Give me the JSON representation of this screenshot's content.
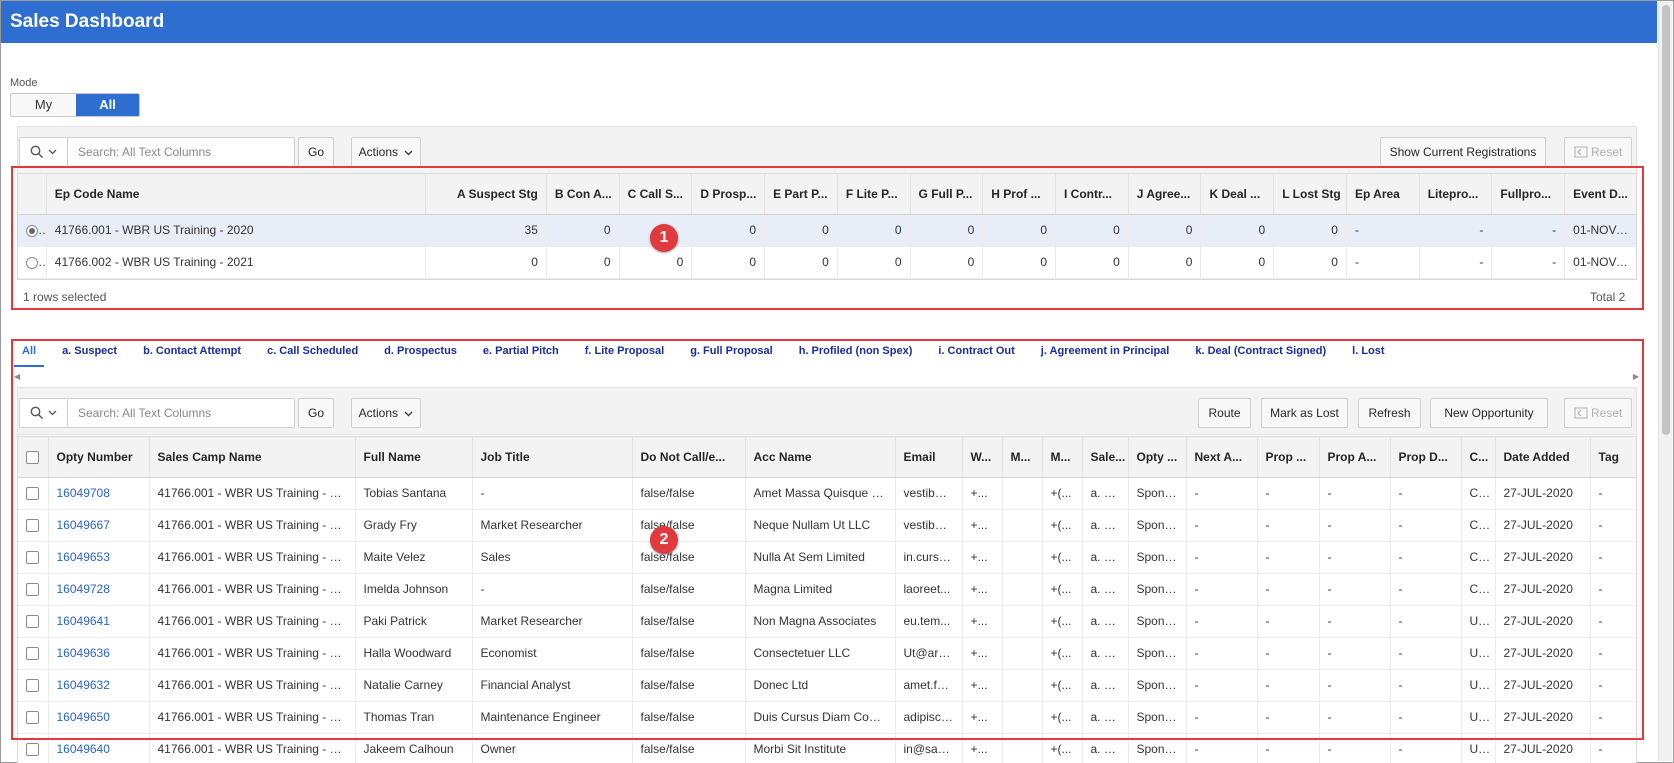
{
  "app": {
    "title": "Sales Dashboard"
  },
  "mode": {
    "label": "Mode",
    "options": [
      "My",
      "All"
    ],
    "selected": "All"
  },
  "top_toolbar": {
    "search_placeholder": "Search: All Text Columns",
    "go_label": "Go",
    "actions_label": "Actions",
    "show_current_label": "Show Current Registrations",
    "reset_label": "Reset"
  },
  "top_grid": {
    "columns": [
      "Ep Code Name",
      "A Suspect Stg",
      "B Con A...",
      "C Call S...",
      "D Prosp...",
      "E Part P...",
      "F Lite P...",
      "G Full P...",
      "H Prof ...",
      "I Contr...",
      "J Agree...",
      "K Deal ...",
      "L Lost Stg",
      "Ep Area",
      "Litepro...",
      "Fullpro...",
      "Event D..."
    ],
    "rows": [
      {
        "selected": true,
        "cells": [
          "41766.001 - WBR US Training - 2020",
          "35",
          "0",
          "",
          "0",
          "0",
          "0",
          "0",
          "0",
          "0",
          "0",
          "0",
          "0",
          "-",
          "-",
          "-",
          "01-NOV-..."
        ]
      },
      {
        "selected": false,
        "cells": [
          "41766.002 - WBR US Training - 2021",
          "0",
          "0",
          "0",
          "0",
          "0",
          "0",
          "0",
          "0",
          "0",
          "0",
          "0",
          "0",
          "-",
          "-",
          "-",
          "01-NOV-..."
        ]
      }
    ],
    "footer_left": "1 rows selected",
    "footer_right": "Total 2"
  },
  "tabs": [
    "All",
    "a. Suspect",
    "b. Contact Attempt",
    "c. Call Scheduled",
    "d. Prospectus",
    "e. Partial Pitch",
    "f. Lite Proposal",
    "g. Full Proposal",
    "h. Profiled (non Spex)",
    "i. Contract Out",
    "j. Agreement in Principal",
    "k. Deal (Contract Signed)",
    "l. Lost"
  ],
  "active_tab": "All",
  "bottom_toolbar": {
    "search_placeholder": "Search: All Text Columns",
    "go_label": "Go",
    "actions_label": "Actions",
    "route_label": "Route",
    "mark_lost_label": "Mark as Lost",
    "refresh_label": "Refresh",
    "new_opp_label": "New Opportunity",
    "reset_label": "Reset"
  },
  "bottom_grid": {
    "columns": [
      "Opty Number",
      "Sales Camp Name",
      "Full Name",
      "Job Title",
      "Do Not Call/e...",
      "Acc Name",
      "Email",
      "W...",
      "M...",
      "M...",
      "Sale...",
      "Opty ...",
      "Next A...",
      "Prop ...",
      "Prop A...",
      "Prop D...",
      "C...",
      "Date Added",
      "Tag"
    ],
    "rows": [
      [
        "16049708",
        "41766.001 - WBR US Training - 20...",
        "Tobias Santana",
        "-",
        "false/false",
        "Amet Massa Quisque C...",
        "vestibul...",
        "+...",
        "",
        "+(...",
        "a. Su...",
        "Spons...",
        "-",
        "-",
        "-",
        "-",
        "Ca...",
        "27-JUL-2020",
        "-"
      ],
      [
        "16049667",
        "41766.001 - WBR US Training - 20...",
        "Grady Fry",
        "Market Researcher",
        "false/false",
        "Neque Nullam Ut LLC",
        "vestibul...",
        "+...",
        "",
        "+(...",
        "a. Su...",
        "Spons...",
        "-",
        "-",
        "-",
        "-",
        "Ca...",
        "27-JUL-2020",
        "-"
      ],
      [
        "16049653",
        "41766.001 - WBR US Training - 20...",
        "Maite Velez",
        "Sales",
        "false/false",
        "Nulla At Sem Limited",
        "in.cursu...",
        "+...",
        "",
        "+(...",
        "a. Su...",
        "Spons...",
        "-",
        "-",
        "-",
        "-",
        "Ca...",
        "27-JUL-2020",
        "-"
      ],
      [
        "16049728",
        "41766.001 - WBR US Training - 20...",
        "Imelda Johnson",
        "-",
        "false/false",
        "Magna Limited",
        "laoreet...",
        "+...",
        "",
        "+(...",
        "a. Su...",
        "Spons...",
        "-",
        "-",
        "-",
        "-",
        "Ca...",
        "27-JUL-2020",
        "-"
      ],
      [
        "16049641",
        "41766.001 - WBR US Training - 20...",
        "Paki Patrick",
        "Market Researcher",
        "false/false",
        "Non Magna Associates",
        "eu.tem...",
        "+...",
        "",
        "+(...",
        "a. Su...",
        "Spons...",
        "-",
        "-",
        "-",
        "-",
        "U...",
        "27-JUL-2020",
        "-"
      ],
      [
        "16049636",
        "41766.001 - WBR US Training - 20...",
        "Halla Woodward",
        "Economist",
        "false/false",
        "Consectetuer LLC",
        "Ut@arc...",
        "+...",
        "",
        "+(...",
        "a. Su...",
        "Spons...",
        "-",
        "-",
        "-",
        "-",
        "U...",
        "27-JUL-2020",
        "-"
      ],
      [
        "16049632",
        "41766.001 - WBR US Training - 20...",
        "Natalie Carney",
        "Financial Analyst",
        "false/false",
        "Donec Ltd",
        "amet.fa...",
        "+...",
        "",
        "+(...",
        "a. Su...",
        "Spons...",
        "-",
        "-",
        "-",
        "-",
        "U...",
        "27-JUL-2020",
        "-"
      ],
      [
        "16049650",
        "41766.001 - WBR US Training - 20...",
        "Thomas Tran",
        "Maintenance Engineer",
        "false/false",
        "Duis Cursus Diam Cons...",
        "adipisci...",
        "+...",
        "",
        "+(...",
        "a. Su...",
        "Spons...",
        "-",
        "-",
        "-",
        "-",
        "U...",
        "27-JUL-2020",
        "-"
      ],
      [
        "16049640",
        "41766.001 - WBR US Training - 20...",
        "Jakeem Calhoun",
        "Owner",
        "false/false",
        "Morbi Sit Institute",
        "in@sag...",
        "+...",
        "",
        "+(...",
        "a. Su...",
        "Spons...",
        "-",
        "-",
        "-",
        "-",
        "U...",
        "27-JUL-2020",
        "-"
      ]
    ]
  },
  "annotations": {
    "badge1": "1",
    "badge2": "2"
  },
  "colors": {
    "header": "#2e6ed0",
    "annotation": "#e0393e",
    "link": "#2866c0",
    "tab": "#1a2c9a"
  }
}
